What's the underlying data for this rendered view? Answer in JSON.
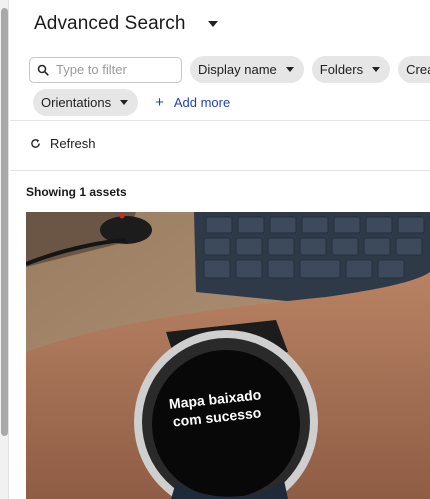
{
  "header": {
    "title": "Advanced Search"
  },
  "search": {
    "placeholder": "Type to filter",
    "value": ""
  },
  "filters": [
    {
      "label": "Display name"
    },
    {
      "label": "Folders"
    },
    {
      "label": "Creatio"
    },
    {
      "label": "Orientations"
    }
  ],
  "add_more": {
    "label": "Add more"
  },
  "toolbar": {
    "refresh_label": "Refresh"
  },
  "results": {
    "summary": "Showing 1 assets"
  },
  "asset": {
    "caption_line1": "Mapa baixado",
    "caption_line2": "com sucesso"
  },
  "icons": {
    "search": "search-icon",
    "refresh": "refresh-icon",
    "plus": "plus-icon"
  },
  "colors": {
    "link": "#2241b8",
    "chip_bg": "#e6e6e6"
  }
}
